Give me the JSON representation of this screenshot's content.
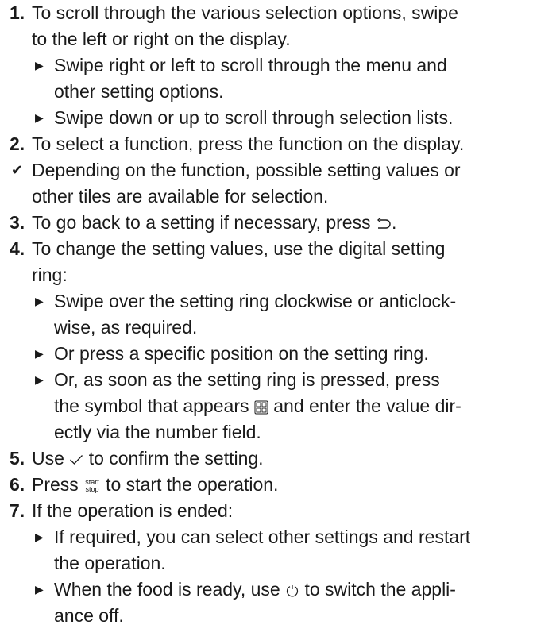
{
  "steps": [
    {
      "num": "1.",
      "lines": [
        "To scroll through the various selection options, swipe",
        "to the left or right on the display."
      ],
      "bullets": [
        {
          "lines": [
            "Swipe right or left to scroll through the menu and",
            "other setting options."
          ]
        },
        {
          "lines": [
            "Swipe down or up to scroll through selection lists."
          ]
        }
      ]
    },
    {
      "num": "2.",
      "lines": [
        "To select a function, press the function on the display."
      ],
      "result": [
        "Depending on the function, possible setting values or",
        "other tiles are available for selection."
      ]
    },
    {
      "num": "3.",
      "text_before": "To go back to a setting if necessary, press",
      "text_after": ".",
      "icon": "back-arrow-icon"
    },
    {
      "num": "4.",
      "lines": [
        "To change the setting values, use the digital setting",
        "ring:"
      ],
      "bullets": [
        {
          "lines": [
            "Swipe over the setting ring clockwise or anticlock-",
            "wise, as required."
          ]
        },
        {
          "lines": [
            "Or press a specific position on the setting ring."
          ]
        },
        {
          "line1": "Or, as soon as the setting ring is pressed, press",
          "line2_before": "the symbol that appears",
          "line2_after": "and enter the value dir-",
          "line3": "ectly via the number field.",
          "icon": "number-field-icon"
        }
      ]
    },
    {
      "num": "5.",
      "text_before": "Use",
      "text_after": "to confirm the setting.",
      "icon": "checkmark-icon"
    },
    {
      "num": "6.",
      "text_before": "Press",
      "text_after": "to start the operation.",
      "icon": "start-stop-icon",
      "icon_text_top": "start",
      "icon_text_bottom": "stop"
    },
    {
      "num": "7.",
      "lines": [
        "If the operation is ended:"
      ],
      "bullets": [
        {
          "lines": [
            "If required, you can select other settings and restart",
            "the operation."
          ]
        },
        {
          "line1_before": "When the food is ready, use",
          "line1_after": "to switch the appli-",
          "line2": "ance off.",
          "icon": "power-icon"
        }
      ]
    }
  ]
}
